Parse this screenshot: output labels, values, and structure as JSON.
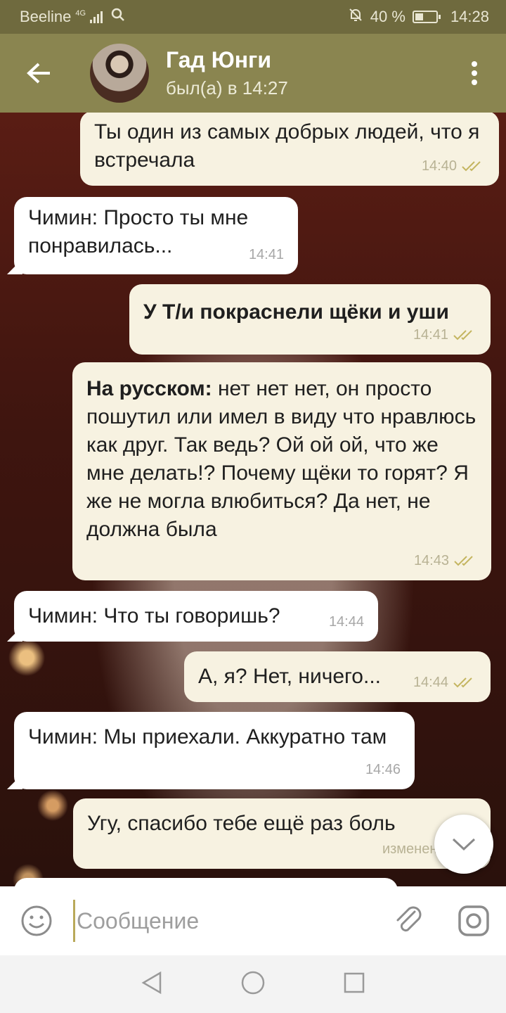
{
  "status": {
    "carrier": "Beeline",
    "network": "4G",
    "battery": "40 %",
    "battery_level": 0.4,
    "time": "14:28"
  },
  "header": {
    "name": "Гад Юнги",
    "last_seen": "был(а) в 14:27"
  },
  "messages": [
    {
      "direction": "out",
      "text": "Ты один из самых добрых людей, что я встречала",
      "time": "14:40",
      "read": true
    },
    {
      "direction": "in",
      "text": "Чимин: Просто ты мне понравилась...",
      "time": "14:41"
    },
    {
      "direction": "out",
      "text": "У Т/и покраснели щёки и уши",
      "time": "14:41",
      "read": true
    },
    {
      "direction": "out",
      "bold": "На русском:",
      "text": " нет нет нет, он просто пошутил или имел в виду что нравлюсь как друг. Так ведь? Ой ой ой, что же мне делать!? Почему щёки то горят? Я же не могла влюбиться? Да нет, не должна была",
      "time": "14:43",
      "read": true
    },
    {
      "direction": "in",
      "text": "Чимин: Что ты говоришь?",
      "time": "14:44"
    },
    {
      "direction": "out",
      "text": "А, я? Нет, ничего...",
      "time": "14:44",
      "read": true
    },
    {
      "direction": "in",
      "text": "Чимин: Мы приехали. Аккуратно там",
      "time": "14:46"
    },
    {
      "direction": "out",
      "text": "Угу, спасибо тебе ещё раз боль",
      "time": "изменено 14:4",
      "read": false
    }
  ],
  "input": {
    "placeholder": "Сообщение"
  }
}
